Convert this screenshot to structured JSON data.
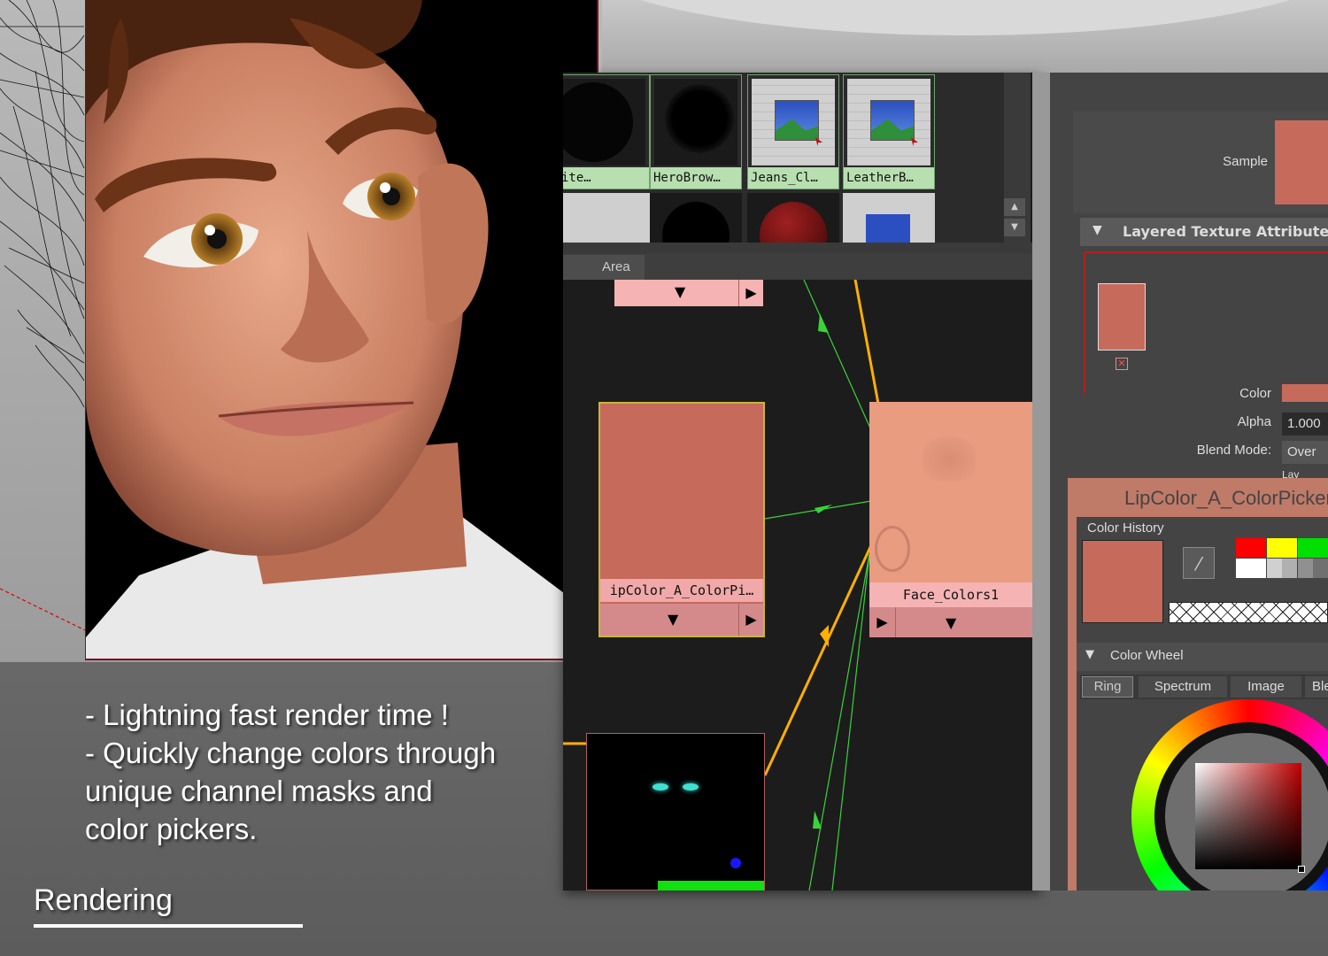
{
  "caption": {
    "lines": [
      "- Lightning fast render time !",
      "- Quickly change colors through",
      "unique channel masks and",
      "color pickers."
    ],
    "section": "Rendering"
  },
  "hypershade": {
    "swatches": [
      "ite…",
      "HeroBrow…",
      "Jeans_Cl…",
      "LeatherB…"
    ],
    "tab_label": "Area",
    "node_left_label": "ipColor_A_ColorPi…",
    "node_right_label": "Face_Colors1"
  },
  "attribute_editor": {
    "sample_label": "Sample",
    "section_title": "Layered Texture Attributes",
    "color_label": "Color",
    "alpha_label": "Alpha",
    "alpha_value": "1.000",
    "blend_label": "Blend Mode:",
    "blend_value": "Over",
    "checkbox_label": "Lay"
  },
  "color_picker": {
    "title": "LipColor_A_ColorPicker",
    "history_label": "Color History",
    "wheel_label": "Color Wheel",
    "tabs": [
      "Ring",
      "Spectrum",
      "Image",
      "Ble"
    ]
  },
  "colors": {
    "skin": "#c66a5c",
    "node_pink": "#f5b3b3",
    "green_wire": "#39d339",
    "orange_wire": "#ffb000"
  }
}
